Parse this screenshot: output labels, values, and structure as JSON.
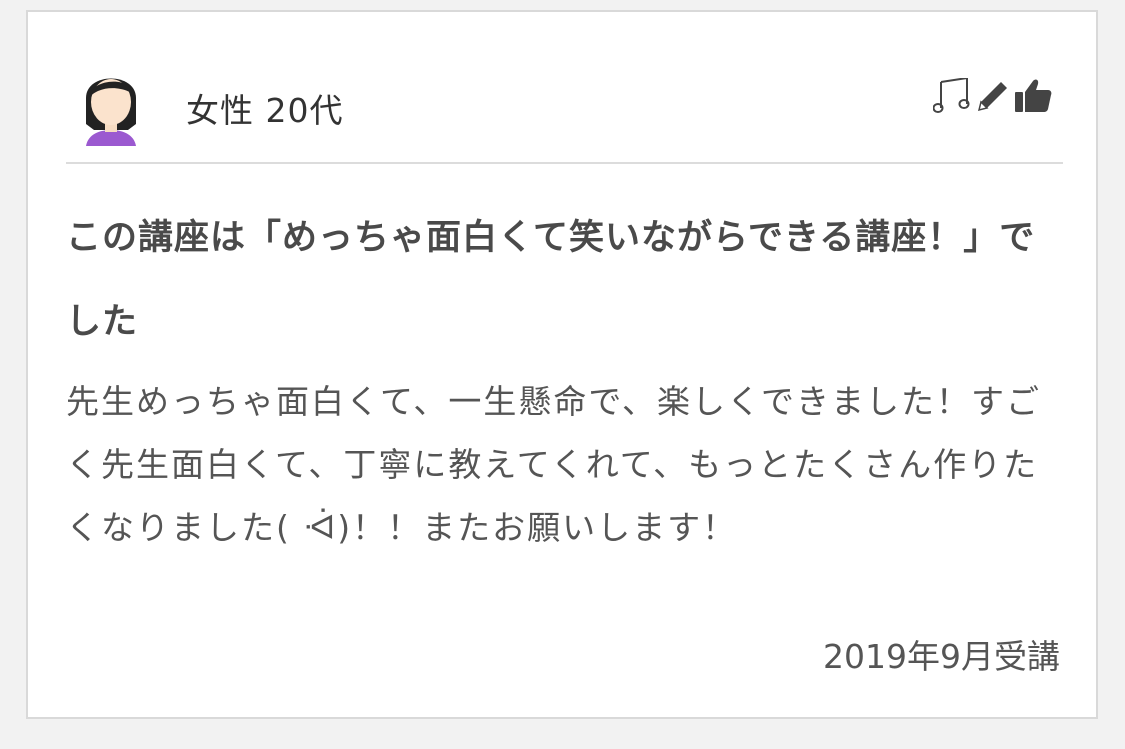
{
  "review": {
    "reviewer": "女性 20代",
    "title": "この講座は「めっちゃ面白くて笑いながらできる講座！」でした",
    "body": "先生めっちゃ面白くて、一生懸命で、楽しくできました！すごく先生面白くて、丁寧に教えてくれて、もっとたくさん作りたくなりました( ᐙ)！！またお願いします！",
    "date": "2019年9月受講",
    "icons": [
      "music-notes-icon",
      "pencil-icon",
      "thumbs-up-icon"
    ],
    "colors": {
      "title": "#4a4a4a",
      "body": "#555555",
      "avatar_hair": "#222222",
      "avatar_shirt": "#9b59d0"
    }
  }
}
